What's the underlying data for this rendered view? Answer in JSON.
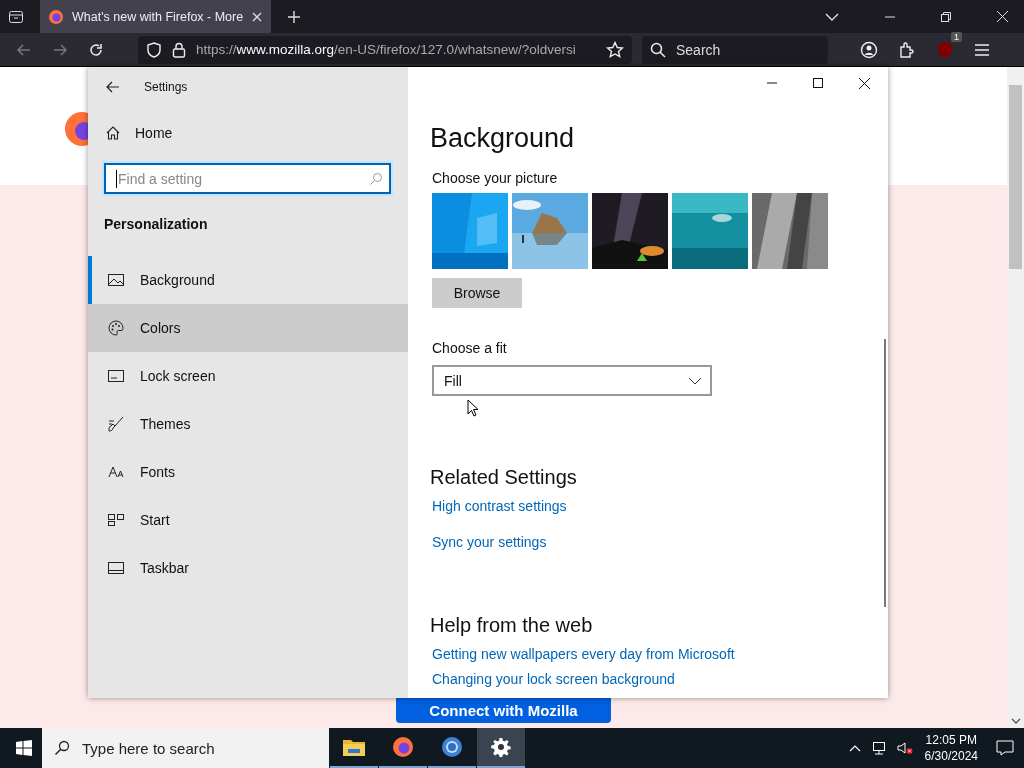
{
  "browser": {
    "tab": {
      "title": "What's new with Firefox - More",
      "selected": true
    },
    "url": {
      "prefix": "https://",
      "host": "www.mozilla.org",
      "path": "/en-US/firefox/127.0/whatsnew/?oldversi"
    },
    "search": {
      "placeholder": "Search"
    },
    "extension_badge": "1"
  },
  "page": {
    "button": "Connect with Mozilla"
  },
  "settings": {
    "window": {
      "title": "Settings"
    },
    "home": "Home",
    "search": {
      "placeholder": "Find a setting"
    },
    "section": "Personalization",
    "nav": [
      {
        "label": "Background",
        "kind": "picture",
        "selected": true,
        "hovered": false
      },
      {
        "label": "Colors",
        "kind": "palette",
        "selected": false,
        "hovered": true
      },
      {
        "label": "Lock screen",
        "kind": "screen",
        "selected": false,
        "hovered": false
      },
      {
        "label": "Themes",
        "kind": "brush",
        "selected": false,
        "hovered": false
      },
      {
        "label": "Fonts",
        "kind": "fonts",
        "selected": false,
        "hovered": false
      },
      {
        "label": "Start",
        "kind": "start",
        "selected": false,
        "hovered": false
      },
      {
        "label": "Taskbar",
        "kind": "taskbar",
        "selected": false,
        "hovered": false
      }
    ],
    "heading": "Background",
    "choose_picture": "Choose your picture",
    "browse": "Browse",
    "choose_fit": "Choose a fit",
    "fit": {
      "value": "Fill"
    },
    "related": {
      "title": "Related Settings",
      "links": [
        "High contrast settings",
        "Sync your settings"
      ]
    },
    "help": {
      "title": "Help from the web",
      "links": [
        "Getting new wallpapers every day from Microsoft",
        "Changing your lock screen background"
      ]
    }
  },
  "taskbar": {
    "search": {
      "placeholder": "Type here to search"
    },
    "apps": [
      {
        "kind": "folder",
        "selected": false
      },
      {
        "kind": "firefox",
        "selected": false
      },
      {
        "kind": "browser",
        "selected": false
      },
      {
        "kind": "gear",
        "selected": true
      }
    ],
    "time": "12:05 PM",
    "date": "6/30/2024"
  }
}
